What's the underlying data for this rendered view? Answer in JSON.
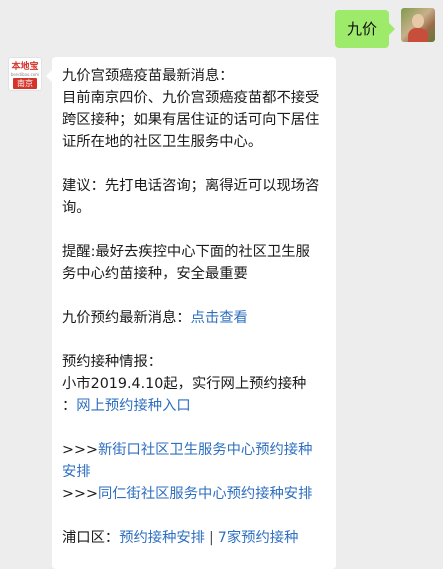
{
  "user_message": {
    "text": "九价"
  },
  "bot": {
    "avatar": {
      "brand": "本地宝",
      "domain": "bendibao.com",
      "city": "南京"
    },
    "news_title": "九价宫颈癌疫苗最新消息：",
    "news_body": "目前南京四价、九价宫颈癌疫苗都不接受跨区接种；如果有居住证的话可向下居住证所在地的社区卫生服务中心。",
    "advice": "建议：先打电话咨询；离得近可以现场咨询。",
    "reminder": "提醒:最好去疾控中心下面的社区卫生服务中心约苗接种，安全最重要",
    "appointment_news": {
      "label": "九价预约最新消息：",
      "link": "点击查看"
    },
    "booking_info": {
      "title": "预约接种情报：",
      "line": "小市2019.4.10起，实行网上预约接种",
      "colon": "：",
      "link": "网上预约接种入口"
    },
    "links": [
      {
        "prefix": ">>>",
        "text": "新街口社区卫生服务中心预约接种安排"
      },
      {
        "prefix": ">>>",
        "text": "同仁街社区服务中心预约接种安排"
      }
    ],
    "pukou": {
      "label": "浦口区：",
      "link1": "预约接种安排",
      "separator": "|",
      "link2": "7家预约接种"
    }
  },
  "colors": {
    "user_bubble": "#9eea6a",
    "bot_bubble": "#ffffff",
    "background": "#ededed",
    "link": "#2e6fc0",
    "brand_red": "#d4352b"
  }
}
